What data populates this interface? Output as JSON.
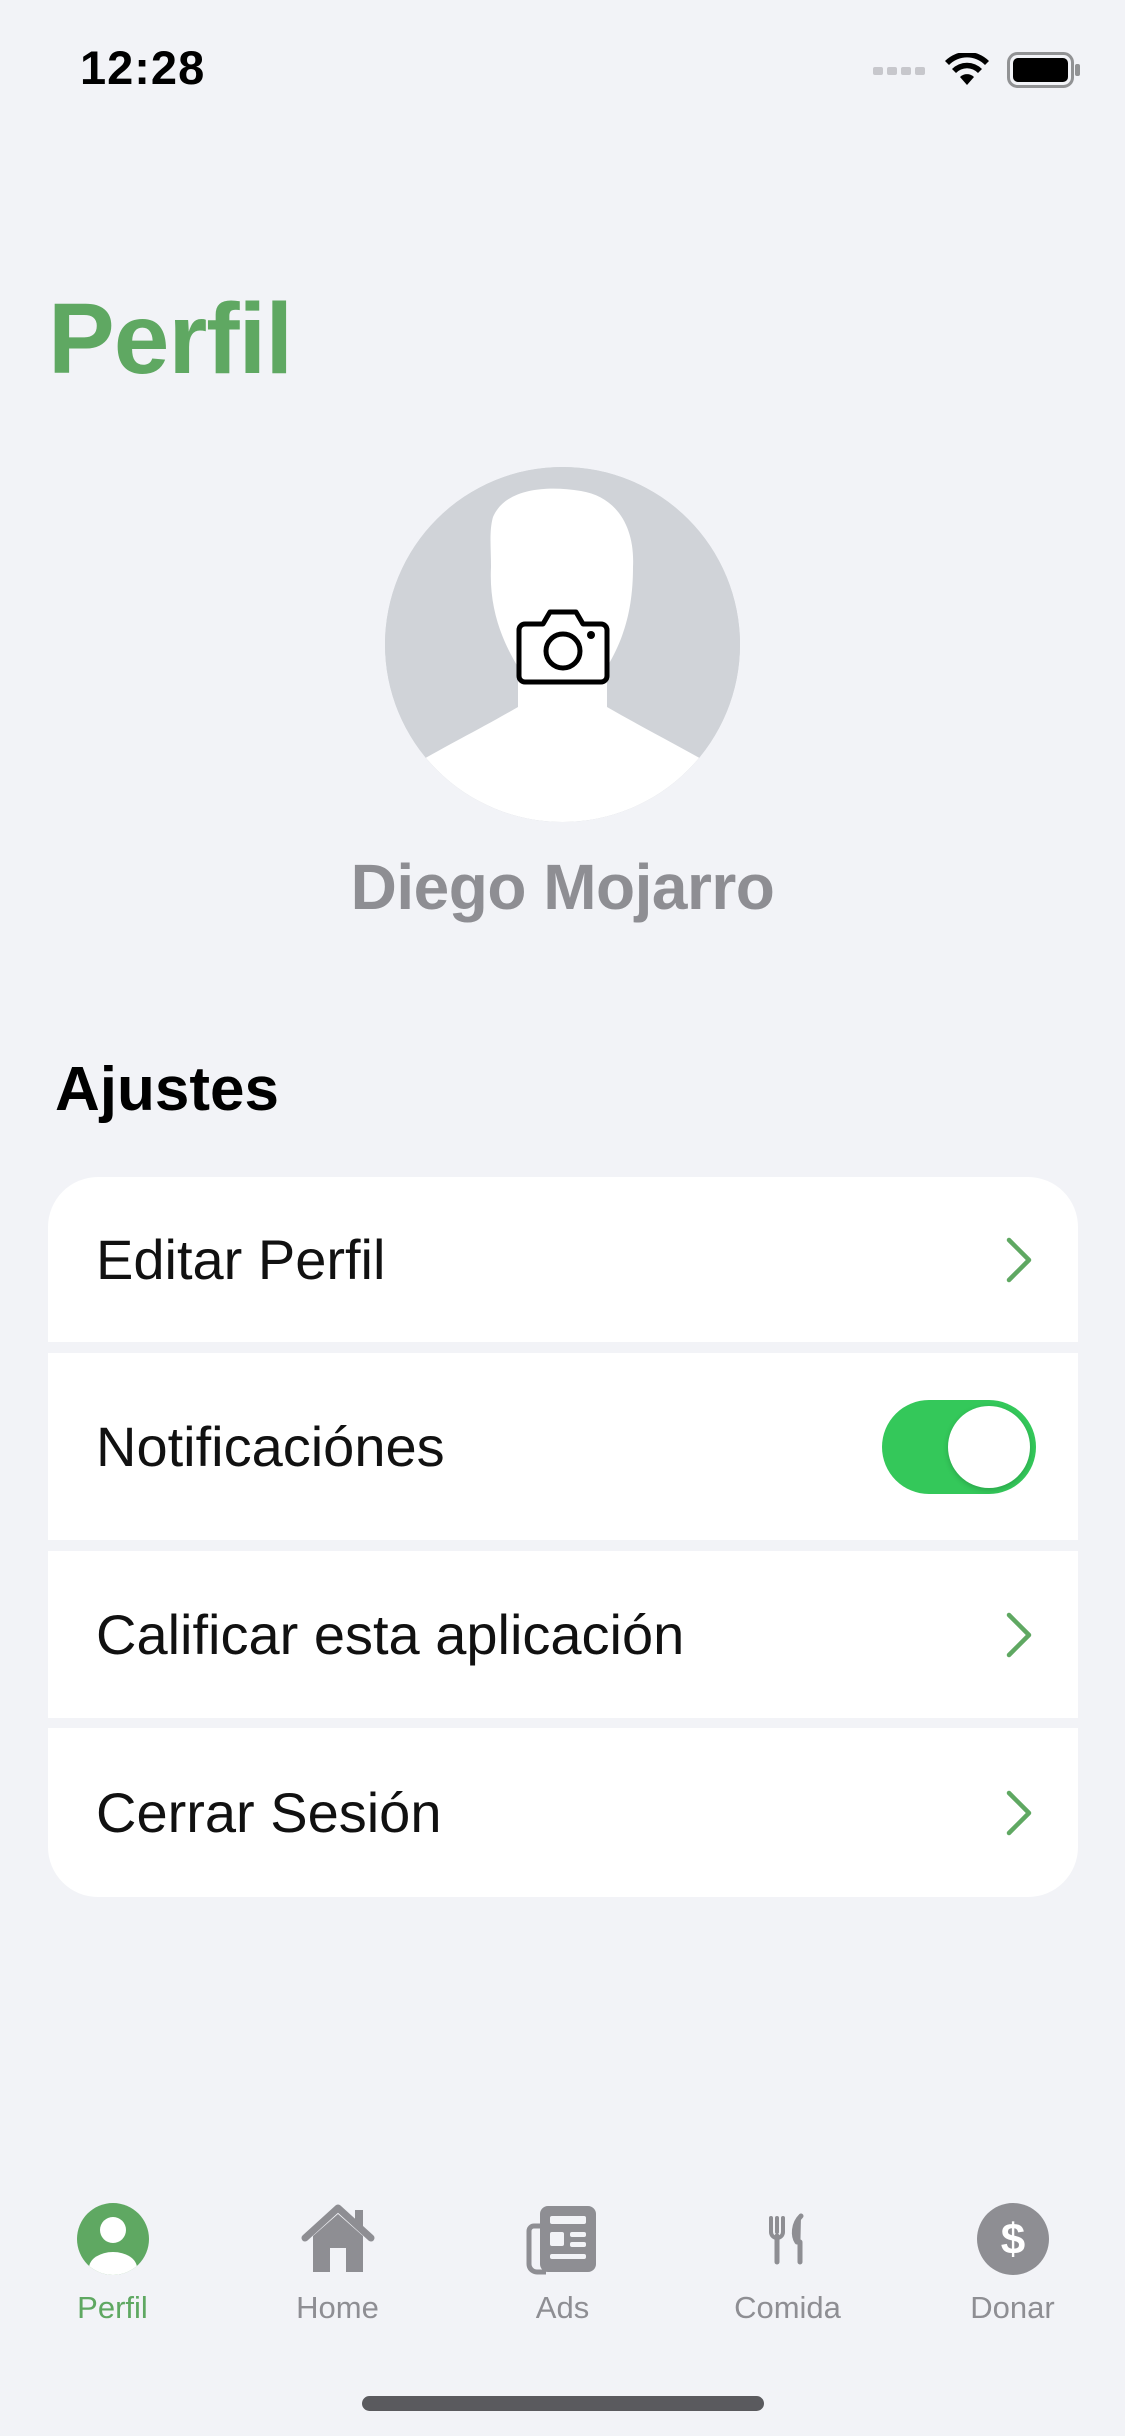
{
  "status_bar": {
    "time": "12:28"
  },
  "header": {
    "title": "Perfil"
  },
  "profile": {
    "name": "Diego Mojarro",
    "avatar_icon": "person-silhouette-icon",
    "camera_icon": "camera-icon"
  },
  "settings": {
    "section_title": "Ajustes",
    "rows": [
      {
        "label": "Editar Perfil",
        "accessory": "chevron-right-icon"
      },
      {
        "label": "Notificaciónes",
        "accessory": "toggle",
        "toggle_on": true
      },
      {
        "label": "Calificar esta aplicación",
        "accessory": "chevron-right-icon"
      },
      {
        "label": "Cerrar Sesión",
        "accessory": "chevron-right-icon"
      }
    ]
  },
  "tab_bar": {
    "tabs": [
      {
        "label": "Perfil",
        "icon": "person-circle-icon",
        "active": true
      },
      {
        "label": "Home",
        "icon": "house-icon",
        "active": false
      },
      {
        "label": "Ads",
        "icon": "newspaper-icon",
        "active": false
      },
      {
        "label": "Comida",
        "icon": "fork-knife-icon",
        "active": false
      },
      {
        "label": "Donar",
        "icon": "dollar-circle-icon",
        "active": false
      }
    ]
  },
  "colors": {
    "accent": "#5fa862",
    "toggle_on": "#34c85a",
    "background": "#f2f3f7",
    "inactive_gray": "#8e8e93"
  }
}
